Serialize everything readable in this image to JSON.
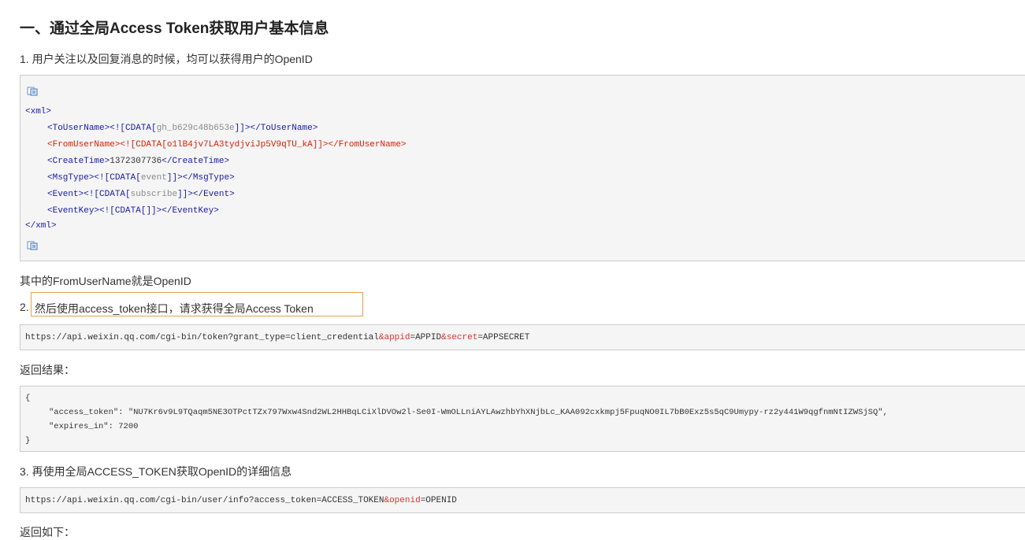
{
  "heading": "一、通过全局Access Token获取用户基本信息",
  "step1": "1. 用户关注以及回复消息的时候，均可以获得用户的OpenID",
  "xml": {
    "open_root": "<xml>",
    "lines": [
      {
        "tag": "ToUserName",
        "value": "gh_b629c48b653e",
        "highlight": false
      },
      {
        "tag": "FromUserName",
        "value": "o1lB4jv7LA3tydjviJp5V9qTU_kA",
        "highlight": true
      },
      {
        "tag": "CreateTime",
        "value": "1372307736",
        "highlight": false,
        "plain": true
      },
      {
        "tag": "MsgType",
        "value": "event",
        "highlight": false
      },
      {
        "tag": "Event",
        "value": "subscribe",
        "highlight": false
      },
      {
        "tag": "EventKey",
        "value": "",
        "highlight": false
      }
    ],
    "close_root": "</xml>"
  },
  "note1": "其中的FromUserName就是OpenID",
  "step2_num": "2.",
  "step2_text": "然后使用access_token接口，请求获得全局Access Token",
  "url1": {
    "part1": "https://api.weixin.qq.com/cgi-bin/token?grant_type=client_credential",
    "amp1": "&appid",
    "part2": "=APPID",
    "amp2": "&secret",
    "part3": "=APPSECRET"
  },
  "result_label": "返回结果：",
  "json_result": {
    "open": "{",
    "line1": "\"access_token\": \"NU7Kr6v9L9TQaqm5NE3OTPctTZx797Wxw4Snd2WL2HHBqLCiXlDVOw2l-Se0I-WmOLLniAYLAwzhbYhXNjbLc_KAA092cxkmpj5FpuqNO0IL7bB0Exz5s5qC9Umypy-rz2y441W9qgfnmNtIZWSjSQ\",",
    "line2": "\"expires_in\": 7200",
    "close": "}"
  },
  "step3": "3. 再使用全局ACCESS_TOKEN获取OpenID的详细信息",
  "url2": {
    "part1": "https://api.weixin.qq.com/cgi-bin/user/info?access_token=ACCESS_TOKEN",
    "amp1": "&openid",
    "part2": "=OPENID"
  },
  "return_label": "返回如下：",
  "colors": {
    "tag": "#1a1aa6",
    "cdata": "#8a8a8a",
    "highlight": "#d81e06",
    "box_bg": "#f5f5f5",
    "focus_border": "#e8a04a"
  },
  "icons": [
    "copy-code-icon"
  ]
}
